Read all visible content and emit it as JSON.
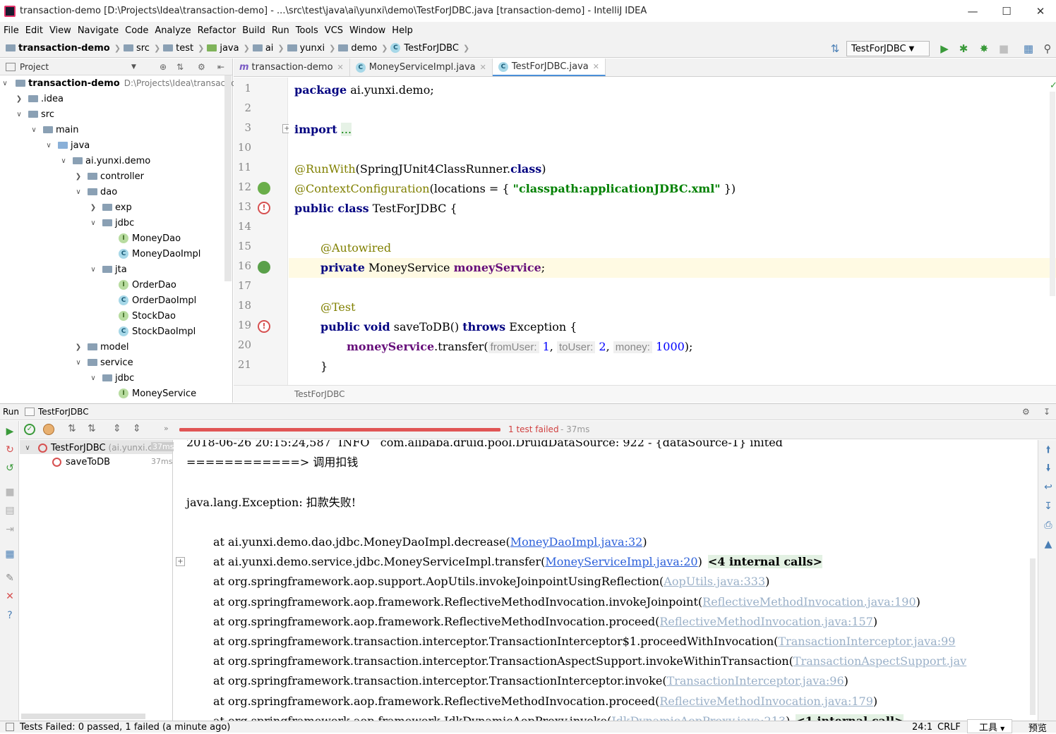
{
  "window": {
    "title": "transaction-demo [D:\\Projects\\Idea\\transaction-demo] - ...\\src\\test\\java\\ai\\yunxi\\demo\\TestForJDBC.java [transaction-demo] - IntelliJ IDEA"
  },
  "menu": [
    "File",
    "Edit",
    "View",
    "Navigate",
    "Code",
    "Analyze",
    "Refactor",
    "Build",
    "Run",
    "Tools",
    "VCS",
    "Window",
    "Help"
  ],
  "breadcrumb": [
    "transaction-demo",
    "src",
    "test",
    "java",
    "ai",
    "yunxi",
    "demo",
    "TestForJDBC"
  ],
  "toolbar": {
    "run_config": "TestForJDBC"
  },
  "project": {
    "header": "Project",
    "root_name": "transaction-demo",
    "root_path": "D:\\Projects\\Idea\\transaction",
    "rows": [
      {
        "label": ".idea"
      },
      {
        "label": "src"
      },
      {
        "label": "main"
      },
      {
        "label": "java"
      },
      {
        "label": "ai.yunxi.demo"
      },
      {
        "label": "controller"
      },
      {
        "label": "dao"
      },
      {
        "label": "exp"
      },
      {
        "label": "jdbc"
      },
      {
        "label": "MoneyDao"
      },
      {
        "label": "MoneyDaoImpl"
      },
      {
        "label": "jta"
      },
      {
        "label": "OrderDao"
      },
      {
        "label": "OrderDaoImpl"
      },
      {
        "label": "StockDao"
      },
      {
        "label": "StockDaoImpl"
      },
      {
        "label": "model"
      },
      {
        "label": "service"
      },
      {
        "label": "jdbc"
      },
      {
        "label": "MoneyService"
      }
    ]
  },
  "editor": {
    "tabs": [
      "transaction-demo",
      "MoneyServiceImpl.java",
      "TestForJDBC.java"
    ],
    "line_numbers": [
      "1",
      "2",
      "3",
      "10",
      "11",
      "12",
      "13",
      "14",
      "15",
      "16",
      "17",
      "18",
      "19",
      "20",
      "21"
    ],
    "code": {
      "l1_kw": "package",
      "l1_rest": " ai.yunxi.demo;",
      "l3_kw": "import",
      "l3_dots": "...",
      "l11_an": "@RunWith",
      "l11_rest": "(SpringJUnit4ClassRunner.",
      "l11_kw": "class",
      "l11_end": ")",
      "l12_an": "@ContextConfiguration",
      "l12_rest": "(locations = { ",
      "l12_str": "\"classpath:applicationJDBC.xml\"",
      "l12_end": " })",
      "l13_kw": "public class",
      "l13_rest": " TestForJDBC {",
      "l15_an": "@Autowired",
      "l16_kw": "private",
      "l16_type": " MoneyService ",
      "l16_fld": "moneyService",
      "l16_end": ";",
      "l18_an": "@Test",
      "l19_kw": "public void",
      "l19_rest": " saveToDB() ",
      "l19_kw2": "throws",
      "l19_end": " Exception {",
      "l20_fld": "moneyService",
      "l20_call": ".transfer(",
      "l20_h1": "fromUser:",
      "l20_v1": "1",
      "l20_h2": "toUser:",
      "l20_v2": "2",
      "l20_h3": "money:",
      "l20_v3": "1000",
      "l20_end": ");",
      "l21": "}"
    },
    "crumb": "TestForJDBC"
  },
  "run": {
    "label": "Run",
    "config": "TestForJDBC",
    "result": "1 test failed",
    "result_time": "- 37ms",
    "tree": {
      "suite": "TestForJDBC",
      "suite_pkg": "(ai.yunxi.c",
      "suite_time": "37ms",
      "test": "saveToDB",
      "test_time": "37ms"
    },
    "console": {
      "l0": "2018-06-26 20:15:24,587  INFO   com.alibaba.druid.pool.DruidDataSource: 922 - {dataSource-1} inited",
      "l1": "============> 调用扣钱",
      "l2": "java.lang.Exception: 扣款失败!",
      "frames": [
        {
          "at": "at ai.yunxi.demo.dao.jdbc.MoneyDaoImpl.decrease(",
          "link": "MoneyDaoImpl.java:32",
          "end": ")",
          "style": "link"
        },
        {
          "at": "at ai.yunxi.demo.service.jdbc.MoneyServiceImpl.transfer(",
          "link": "MoneyServiceImpl.java:20",
          "end": ")",
          "extra": "<4 internal calls>",
          "style": "link"
        },
        {
          "at": "at org.springframework.aop.support.AopUtils.invokeJoinpointUsingReflection(",
          "link": "AopUtils.java:333",
          "end": ")",
          "style": "glink"
        },
        {
          "at": "at org.springframework.aop.framework.ReflectiveMethodInvocation.invokeJoinpoint(",
          "link": "ReflectiveMethodInvocation.java:190",
          "end": ")",
          "style": "glink"
        },
        {
          "at": "at org.springframework.aop.framework.ReflectiveMethodInvocation.proceed(",
          "link": "ReflectiveMethodInvocation.java:157",
          "end": ")",
          "style": "glink"
        },
        {
          "at": "at org.springframework.transaction.interceptor.TransactionInterceptor$1.proceedWithInvocation(",
          "link": "TransactionInterceptor.java:99",
          "end": "",
          "style": "glink"
        },
        {
          "at": "at org.springframework.transaction.interceptor.TransactionAspectSupport.invokeWithinTransaction(",
          "link": "TransactionAspectSupport.jav",
          "end": "",
          "style": "glink"
        },
        {
          "at": "at org.springframework.transaction.interceptor.TransactionInterceptor.invoke(",
          "link": "TransactionInterceptor.java:96",
          "end": ")",
          "style": "glink"
        },
        {
          "at": "at org.springframework.aop.framework.ReflectiveMethodInvocation.proceed(",
          "link": "ReflectiveMethodInvocation.java:179",
          "end": ")",
          "style": "glink"
        },
        {
          "at": "at org.springframework.aop.framework.JdkDynamicAopProxy.invoke(",
          "link": "JdkDynamicAopProxy.java:213",
          "end": ")",
          "extra": "<1 internal call>",
          "style": "glink"
        }
      ]
    },
    "progress": 1.0
  },
  "status": {
    "message": "Tests Failed: 0 passed, 1 failed (a minute ago)",
    "position": "24:1",
    "line_sep": "CRLF",
    "tools": "工具",
    "preview": "预览"
  },
  "colors": {
    "fail_red": "#e05555",
    "keyword": "#000080",
    "annotation": "#808000",
    "string": "#008000",
    "field": "#660e7a",
    "link": "#2b5fd9"
  }
}
